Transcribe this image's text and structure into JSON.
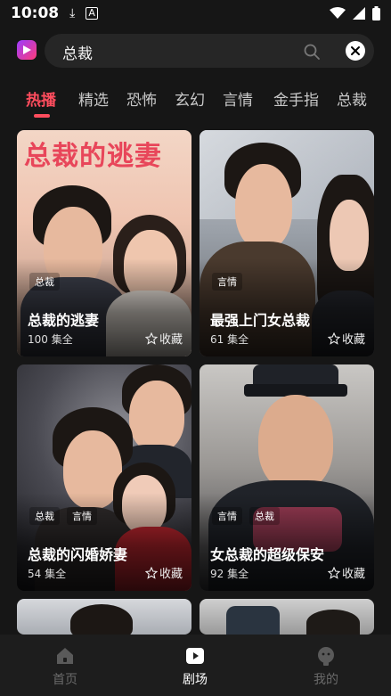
{
  "status_bar": {
    "time": "10:08"
  },
  "search": {
    "query": "总裁"
  },
  "tabs": [
    {
      "label": "热播",
      "active": true
    },
    {
      "label": "精选"
    },
    {
      "label": "恐怖"
    },
    {
      "label": "玄幻"
    },
    {
      "label": "言情"
    },
    {
      "label": "金手指"
    },
    {
      "label": "总裁"
    }
  ],
  "cards": [
    {
      "title": "总裁的逃妻",
      "episodes": "100 集全",
      "tags": [
        "总裁"
      ],
      "fav_label": "收藏",
      "poster_caption": "总裁的逃妻"
    },
    {
      "title": "最强上门女总裁",
      "episodes": "61 集全",
      "tags": [
        "言情"
      ],
      "fav_label": "收藏"
    },
    {
      "title": "总裁的闪婚娇妻",
      "episodes": "54 集全",
      "tags": [
        "总裁",
        "言情"
      ],
      "fav_label": "收藏"
    },
    {
      "title": "女总裁的超级保安",
      "episodes": "92 集全",
      "tags": [
        "言情",
        "总裁"
      ],
      "fav_label": "收藏"
    }
  ],
  "bottom_nav": [
    {
      "label": "首页",
      "icon": "home-icon",
      "active": false
    },
    {
      "label": "剧场",
      "icon": "play-icon",
      "active": true
    },
    {
      "label": "我的",
      "icon": "profile-icon",
      "active": false
    }
  ],
  "colors": {
    "accent": "#ff4d5e",
    "background": "#161616"
  }
}
